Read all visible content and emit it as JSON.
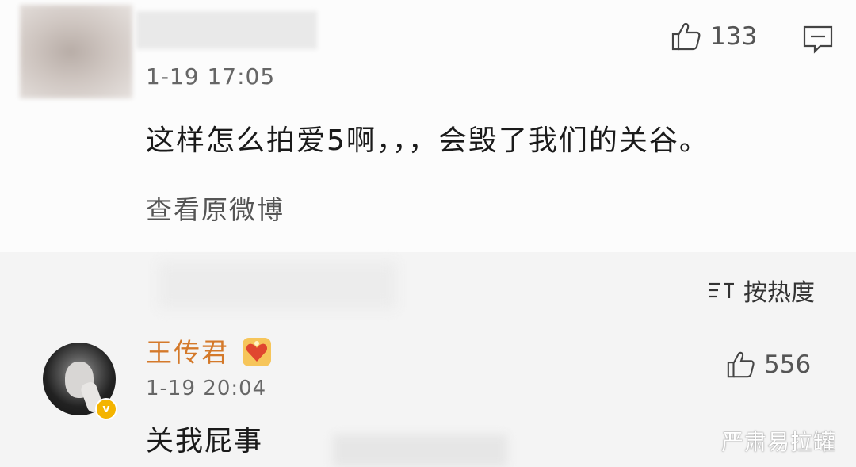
{
  "comment1": {
    "likes": "133",
    "time": "1-19 17:05",
    "text": "这样怎么拍爱5啊，，，会毁了我们的关谷。",
    "view_original": "查看原微博"
  },
  "sort": {
    "label": "按热度"
  },
  "comment2": {
    "username": "王传君",
    "likes": "556",
    "time": "1-19 20:04",
    "text": "关我屁事"
  },
  "watermark": "严肃易拉罐",
  "icons": {
    "like": "thumbs-up-icon",
    "comment": "comment-icon",
    "sort": "sort-icon",
    "verified": "verified-badge-icon",
    "vip": "vip-heart-icon"
  },
  "colors": {
    "username": "#d4792a",
    "verify_badge": "#f4b400"
  }
}
